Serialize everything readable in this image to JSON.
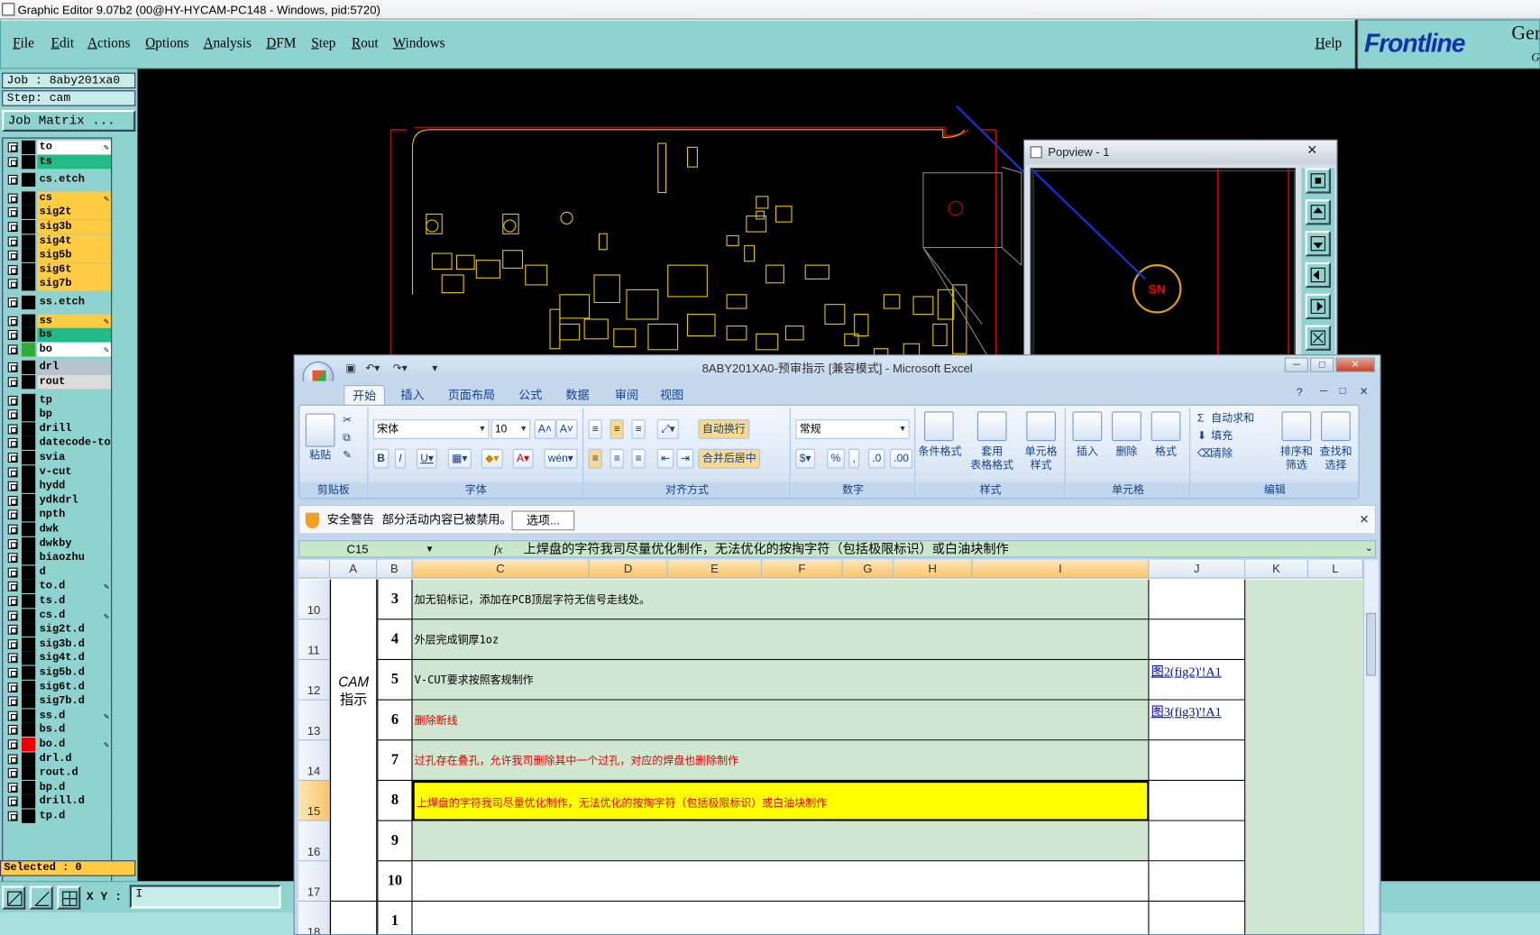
{
  "window_title": "Graphic Editor 9.07b2 (00@HY-HYCAM-PC148 - Windows, pid:5720)",
  "menu": [
    "File",
    "Edit",
    "Actions",
    "Options",
    "Analysis",
    "DFM",
    "Step",
    "Rout",
    "Windows"
  ],
  "help": "Help",
  "logo": {
    "brand": "Frontline",
    "partial": "Ger",
    "partial2": "G"
  },
  "job": "Job : 8aby201xa0",
  "step": "Step: cam",
  "job_matrix": "Job Matrix ...",
  "layers": [
    {
      "name": "to",
      "color": "c-w",
      "swatch": "#000",
      "pen": true
    },
    {
      "name": "ts",
      "color": "c-g",
      "swatch": "#000",
      "pen": false
    },
    {
      "name": "cs.etch",
      "color": "c-t",
      "swatch": "#000",
      "pen": false
    },
    {
      "name": "cs",
      "color": "c-o",
      "swatch": "#000",
      "pen": true
    },
    {
      "name": "sig2t",
      "color": "c-o",
      "swatch": "#000",
      "pen": false
    },
    {
      "name": "sig3b",
      "color": "c-o",
      "swatch": "#000",
      "pen": false
    },
    {
      "name": "sig4t",
      "color": "c-o",
      "swatch": "#000",
      "pen": false
    },
    {
      "name": "sig5b",
      "color": "c-o",
      "swatch": "#000",
      "pen": false
    },
    {
      "name": "sig6t",
      "color": "c-o",
      "swatch": "#000",
      "pen": false
    },
    {
      "name": "sig7b",
      "color": "c-o",
      "swatch": "#000",
      "pen": false
    },
    {
      "name": "ss.etch",
      "color": "c-t",
      "swatch": "#000",
      "pen": false
    },
    {
      "name": "ss",
      "color": "c-o",
      "swatch": "#000",
      "pen": true
    },
    {
      "name": "bs",
      "color": "c-g",
      "swatch": "#000",
      "pen": false
    },
    {
      "name": "bo",
      "color": "c-w",
      "swatch": "#3a3",
      "pen": true
    },
    {
      "name": "drl",
      "color": "c-s",
      "swatch": "#000",
      "pen": false
    },
    {
      "name": "rout",
      "color": "c-l",
      "swatch": "#000",
      "pen": false
    },
    {
      "name": "tp",
      "color": "c-t",
      "swatch": "#000",
      "pen": false
    },
    {
      "name": "bp",
      "color": "c-t",
      "swatch": "#000",
      "pen": false
    },
    {
      "name": "drill",
      "color": "c-t",
      "swatch": "#000",
      "pen": false
    },
    {
      "name": "datecode-to",
      "color": "c-t",
      "swatch": "#000",
      "pen": false
    },
    {
      "name": "svia",
      "color": "c-t",
      "swatch": "#000",
      "pen": false
    },
    {
      "name": "v-cut",
      "color": "c-t",
      "swatch": "#000",
      "pen": false
    },
    {
      "name": "hydd",
      "color": "c-t",
      "swatch": "#000",
      "pen": false
    },
    {
      "name": "ydkdrl",
      "color": "c-t",
      "swatch": "#000",
      "pen": false
    },
    {
      "name": "npth",
      "color": "c-t",
      "swatch": "#000",
      "pen": false
    },
    {
      "name": "dwk",
      "color": "c-t",
      "swatch": "#000",
      "pen": false
    },
    {
      "name": "dwkby",
      "color": "c-t",
      "swatch": "#000",
      "pen": false
    },
    {
      "name": "biaozhu",
      "color": "c-t",
      "swatch": "#000",
      "pen": false
    },
    {
      "name": "d",
      "color": "c-t",
      "swatch": "#000",
      "pen": false
    },
    {
      "name": "to.d",
      "color": "c-t",
      "swatch": "#000",
      "pen": true
    },
    {
      "name": "ts.d",
      "color": "c-t",
      "swatch": "#000",
      "pen": false
    },
    {
      "name": "cs.d",
      "color": "c-t",
      "swatch": "#000",
      "pen": true
    },
    {
      "name": "sig2t.d",
      "color": "c-t",
      "swatch": "#000",
      "pen": false
    },
    {
      "name": "sig3b.d",
      "color": "c-t",
      "swatch": "#000",
      "pen": false
    },
    {
      "name": "sig4t.d",
      "color": "c-t",
      "swatch": "#000",
      "pen": false
    },
    {
      "name": "sig5b.d",
      "color": "c-t",
      "swatch": "#000",
      "pen": false
    },
    {
      "name": "sig6t.d",
      "color": "c-t",
      "swatch": "#000",
      "pen": false
    },
    {
      "name": "sig7b.d",
      "color": "c-t",
      "swatch": "#000",
      "pen": false
    },
    {
      "name": "ss.d",
      "color": "c-t",
      "swatch": "#000",
      "pen": true
    },
    {
      "name": "bs.d",
      "color": "c-t",
      "swatch": "#000",
      "pen": false
    },
    {
      "name": "bo.d",
      "color": "c-t",
      "swatch": "#e00",
      "pen": true
    },
    {
      "name": "drl.d",
      "color": "c-t",
      "swatch": "#000",
      "pen": false
    },
    {
      "name": "rout.d",
      "color": "c-t",
      "swatch": "#000",
      "pen": false
    },
    {
      "name": "bp.d",
      "color": "c-t",
      "swatch": "#000",
      "pen": false
    },
    {
      "name": "drill.d",
      "color": "c-t",
      "swatch": "#000",
      "pen": false
    },
    {
      "name": "tp.d",
      "color": "c-t",
      "swatch": "#000",
      "pen": false
    }
  ],
  "selected": "Selected : 0",
  "xy_label": "X Y :",
  "xy_value": "I",
  "popview": {
    "title": "Popview - 1",
    "close": "✕",
    "marker": "SN"
  },
  "excel": {
    "title": "8ABY201XA0-预审指示 [兼容模式] - Microsoft Excel",
    "tabs": [
      "开始",
      "插入",
      "页面布局",
      "公式",
      "数据",
      "审阅",
      "视图"
    ],
    "ribbon": {
      "paste": "粘贴",
      "clipboard": "剪贴板",
      "font_name": "宋体",
      "font_size": "10",
      "font": "字体",
      "wrap": "自动换行",
      "merge": "合并后居中",
      "align": "对齐方式",
      "numfmt": "常规",
      "number": "数字",
      "cond": "条件格式",
      "table1": "套用",
      "table2": "表格格式",
      "cell1": "单元格",
      "cell2": "样式",
      "styles": "样式",
      "insert": "插入",
      "delete": "删除",
      "format": "格式",
      "cells": "单元格",
      "autosum": "自动求和",
      "fill": "填充",
      "clear": "清除",
      "sort1": "排序和",
      "sort2": "筛选",
      "find1": "查找和",
      "find2": "选择",
      "editing": "编辑"
    },
    "security": {
      "label": "安全警告",
      "text": "部分活动内容已被禁用。",
      "button": "选项..."
    },
    "namebox": "C15",
    "fx": "fx",
    "formula": "上焊盘的字符我司尽量优化制作，无法优化的按掏字符（包括极限标识）或白油块制作",
    "col_headers": [
      "A",
      "B",
      "C",
      "D",
      "E",
      "F",
      "G",
      "H",
      "I",
      "J",
      "K",
      "L"
    ],
    "cam_label": [
      "CAM",
      "指示"
    ],
    "rows": [
      {
        "row": "10",
        "num": "3",
        "text": "加无铅标记，添加在PCB顶层字符无信号走线处。",
        "red": false,
        "link": ""
      },
      {
        "row": "11",
        "num": "4",
        "text": "外层完成铜厚1oz",
        "red": false,
        "link": ""
      },
      {
        "row": "12",
        "num": "5",
        "text": "V-CUT要求按照客规制作",
        "red": false,
        "link": "图2(fig2)'!A1"
      },
      {
        "row": "13",
        "num": "6",
        "text": "删除断线",
        "red": true,
        "link": "图3(fig3)'!A1"
      },
      {
        "row": "14",
        "num": "7",
        "text": "过孔存在叠孔，允许我司删除其中一个过孔，对应的焊盘也删除制作",
        "red": true,
        "link": ""
      },
      {
        "row": "15",
        "num": "8",
        "text": "上焊盘的字符我司尽量优化制作，无法优化的按掏字符（包括极限标识）或白油块制作",
        "red": true,
        "link": ""
      },
      {
        "row": "16",
        "num": "9",
        "text": "",
        "red": false,
        "link": ""
      },
      {
        "row": "17",
        "num": "10",
        "text": "",
        "red": false,
        "link": ""
      },
      {
        "row": "18",
        "num": "1",
        "text": "",
        "red": false,
        "link": ""
      }
    ]
  }
}
